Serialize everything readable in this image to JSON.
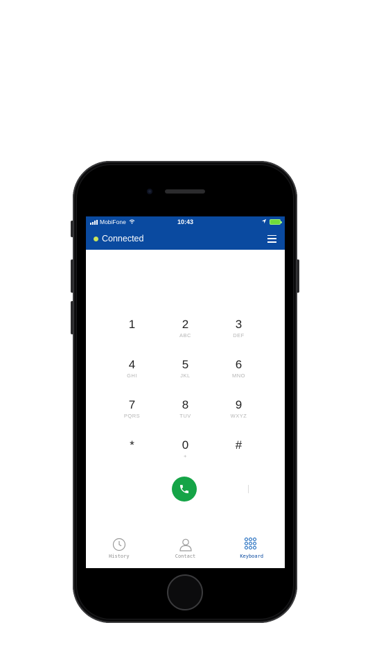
{
  "status_bar": {
    "carrier": "MobiFone",
    "time": "10:43"
  },
  "header": {
    "connection_status": "Connected",
    "status_color": "#c9e35a",
    "accent_color": "#0a4aa0"
  },
  "keypad": {
    "keys": [
      {
        "digit": "1",
        "letters": ""
      },
      {
        "digit": "2",
        "letters": "ABC"
      },
      {
        "digit": "3",
        "letters": "DEF"
      },
      {
        "digit": "4",
        "letters": "GHI"
      },
      {
        "digit": "5",
        "letters": "JKL"
      },
      {
        "digit": "6",
        "letters": "MNO"
      },
      {
        "digit": "7",
        "letters": "PQRS"
      },
      {
        "digit": "8",
        "letters": "TUV"
      },
      {
        "digit": "9",
        "letters": "WXYZ"
      },
      {
        "digit": "*",
        "letters": ""
      },
      {
        "digit": "0",
        "letters": "+"
      },
      {
        "digit": "#",
        "letters": ""
      }
    ]
  },
  "call_button": {
    "icon": "phone-icon",
    "color": "#15a447"
  },
  "tabs": [
    {
      "label": "History",
      "icon": "clock-icon",
      "active": false
    },
    {
      "label": "Contact",
      "icon": "person-icon",
      "active": false
    },
    {
      "label": "Keyboard",
      "icon": "dialpad-icon",
      "active": true
    }
  ]
}
